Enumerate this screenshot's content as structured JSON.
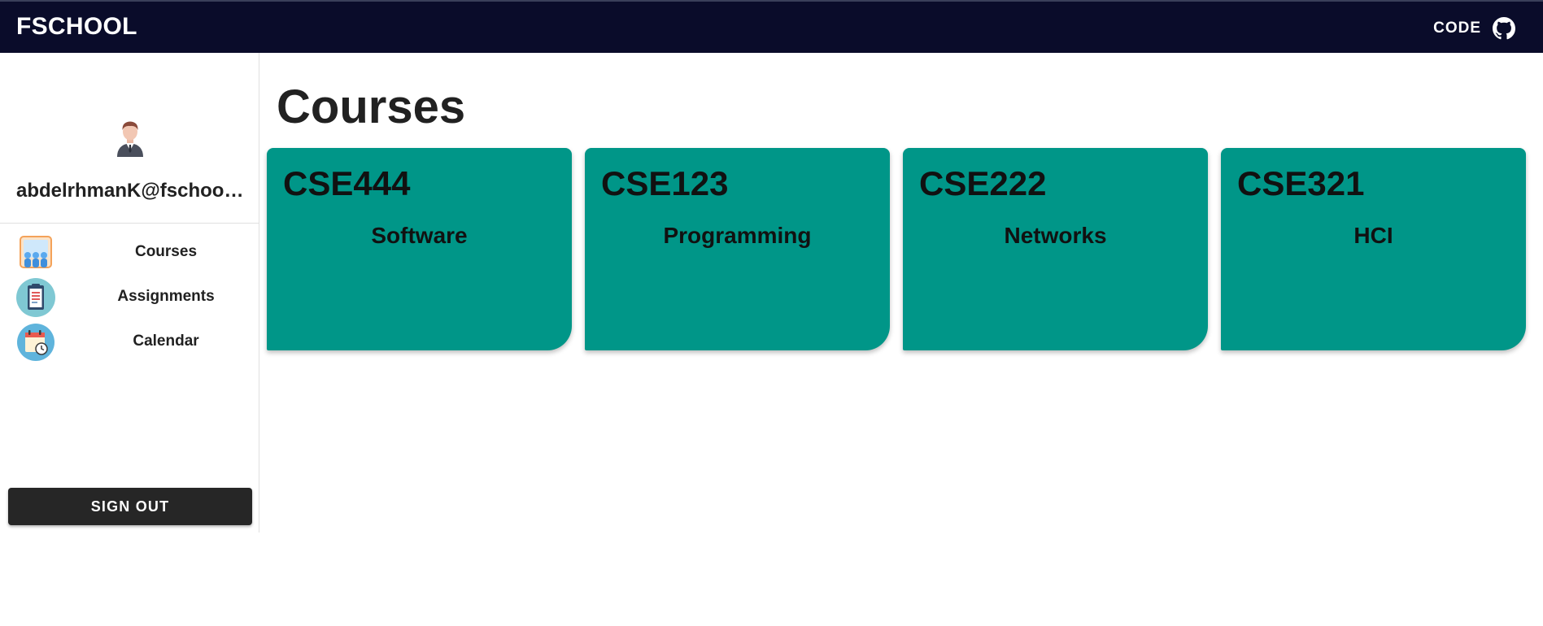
{
  "app": {
    "brand": "FSCHOOL",
    "code_label": "CODE",
    "code_icon": "github-icon"
  },
  "sidebar": {
    "avatar_icon": "user-avatar-icon",
    "user_email": "abdelrhmanK@fschool.com",
    "items": [
      {
        "label": "Courses",
        "icon": "courses-icon"
      },
      {
        "label": "Assignments",
        "icon": "clipboard-icon"
      },
      {
        "label": "Calendar",
        "icon": "calendar-icon"
      }
    ],
    "signout_label": "SIGN OUT"
  },
  "main": {
    "title": "Courses",
    "courses": [
      {
        "code": "CSE444",
        "name": "Software"
      },
      {
        "code": "CSE123",
        "name": "Programming"
      },
      {
        "code": "CSE222",
        "name": "Networks"
      },
      {
        "code": "CSE321",
        "name": "HCI"
      }
    ]
  },
  "colors": {
    "topbar": "#0a0c2a",
    "card": "#009688",
    "signout": "#262626"
  }
}
